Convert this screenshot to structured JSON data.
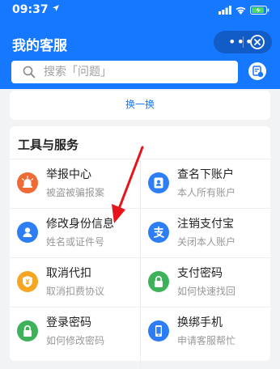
{
  "status_bar": {
    "time": "09:37"
  },
  "header": {
    "title": "我的客服"
  },
  "search": {
    "placeholder": "搜索「问题」"
  },
  "recommend": {
    "swap_label": "换一换"
  },
  "tools": {
    "title": "工具与服务",
    "items": [
      {
        "title": "举报中心",
        "subtitle": "被盗被骗报案",
        "icon": "alarm-icon",
        "color": "#f06a35"
      },
      {
        "title": "查名下账户",
        "subtitle": "本人所有账户",
        "icon": "account-card-icon",
        "color": "#2d7ef4"
      },
      {
        "title": "修改身份信息",
        "subtitle": "姓名或证件号",
        "icon": "person-icon",
        "color": "#2d7ef4"
      },
      {
        "title": "注销支付宝",
        "subtitle": "关闭本人账户",
        "icon": "alipay-icon",
        "color": "#2d7ef4"
      },
      {
        "title": "取消代扣",
        "subtitle": "取消扣费协议",
        "icon": "shield-yen-icon",
        "color": "#f5a623"
      },
      {
        "title": "支付密码",
        "subtitle": "如何快速找回",
        "icon": "lock-icon",
        "color": "#3db25b"
      },
      {
        "title": "登录密码",
        "subtitle": "如何修改密码",
        "icon": "lock-icon",
        "color": "#3db25b"
      },
      {
        "title": "换绑手机",
        "subtitle": "申请客服帮忙",
        "icon": "phone-icon",
        "color": "#2d7ef4"
      }
    ]
  }
}
